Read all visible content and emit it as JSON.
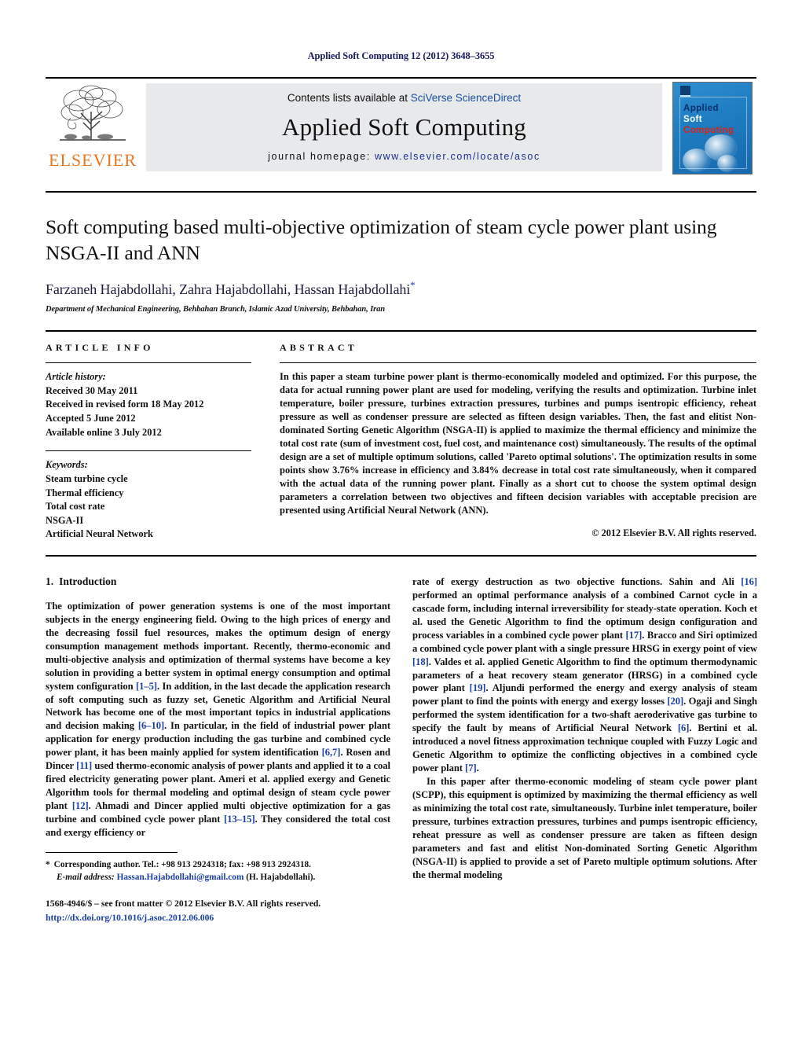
{
  "running_head": "Applied Soft Computing 12 (2012) 3648–3655",
  "banner": {
    "publisher_logo_text": "ELSEVIER",
    "contents_prefix": "Contents lists available at ",
    "contents_link": "SciVerse ScienceDirect",
    "journal_title": "Applied Soft Computing",
    "homepage_prefix": "journal homepage: ",
    "homepage_url": "www.elsevier.com/locate/asoc",
    "cover": {
      "line1": "Applied",
      "line2": "Soft",
      "line3": "Computing",
      "color_line1": "#0b2f6b",
      "color_line2": "#ffffff",
      "color_line3": "#e02213",
      "background_color": "#1f7ec2"
    }
  },
  "article": {
    "title": "Soft computing based multi-objective optimization of steam cycle power plant using NSGA-II and ANN",
    "authors": "Farzaneh Hajabdollahi, Zahra Hajabdollahi, Hassan Hajabdollahi",
    "corresponding_marker": "*",
    "affiliation": "Department of Mechanical Engineering, Behbahan Branch, Islamic Azad University, Behbahan, Iran"
  },
  "article_info": {
    "label": "ARTICLE INFO",
    "history_label": "Article history:",
    "history": [
      "Received 30 May 2011",
      "Received in revised form 18 May 2012",
      "Accepted 5 June 2012",
      "Available online 3 July 2012"
    ],
    "keywords_label": "Keywords:",
    "keywords": [
      "Steam turbine cycle",
      "Thermal efficiency",
      "Total cost rate",
      "NSGA-II",
      "Artificial Neural Network"
    ]
  },
  "abstract": {
    "label": "ABSTRACT",
    "text": "In this paper a steam turbine power plant is thermo-economically modeled and optimized. For this purpose, the data for actual running power plant are used for modeling, verifying the results and optimization. Turbine inlet temperature, boiler pressure, turbines extraction pressures, turbines and pumps isentropic efficiency, reheat pressure as well as condenser pressure are selected as fifteen design variables. Then, the fast and elitist Non-dominated Sorting Genetic Algorithm (NSGA-II) is applied to maximize the thermal efficiency and minimize the total cost rate (sum of investment cost, fuel cost, and maintenance cost) simultaneously. The results of the optimal design are a set of multiple optimum solutions, called 'Pareto optimal solutions'. The optimization results in some points show 3.76% increase in efficiency and 3.84% decrease in total cost rate simultaneously, when it compared with the actual data of the running power plant. Finally as a short cut to choose the system optimal design parameters a correlation between two objectives and fifteen decision variables with acceptable precision are presented using Artificial Neural Network (ANN).",
    "copyright": "© 2012 Elsevier B.V. All rights reserved."
  },
  "introduction": {
    "heading_number": "1.",
    "heading_text": "Introduction",
    "left_paragraph_1_a": "The optimization of power generation systems is one of the most important subjects in the energy engineering field. Owing to the high prices of energy and the decreasing fossil fuel resources, makes the optimum design of energy consumption management methods important. Recently, thermo-economic and multi-objective analysis and optimization of thermal systems have become a key solution in providing a better system in optimal energy consumption and optimal system configuration ",
    "cite_1_5": "[1–5]",
    "left_paragraph_1_b": ". In addition, in the last decade the application research of soft computing such as fuzzy set, Genetic Algorithm and Artificial Neural Network has become one of the most important topics in industrial applications and decision making ",
    "cite_6_10": "[6–10]",
    "left_paragraph_1_c": ". In particular, in the field of industrial power plant application for energy production including the gas turbine and combined cycle power plant, it has been mainly applied for system identification ",
    "cite_6_7": "[6,7]",
    "left_paragraph_1_d": ". Rosen and Dincer ",
    "cite_11": "[11]",
    "left_paragraph_1_e": " used thermo-economic analysis of power plants and applied it to a coal fired electricity generating power plant. Ameri et al. applied exergy and Genetic Algorithm tools for thermal modeling and optimal design of steam cycle power plant ",
    "cite_12": "[12]",
    "left_paragraph_1_f": ". Ahmadi and Dincer applied multi objective optimization for a gas turbine and combined cycle power plant ",
    "cite_13_15": "[13–15]",
    "left_paragraph_1_g": ". They considered the total cost and exergy efficiency or",
    "right_paragraph_1_a": "rate of exergy destruction as two objective functions. Sahin and Ali ",
    "cite_16": "[16]",
    "right_paragraph_1_b": " performed an optimal performance analysis of a combined Carnot cycle in a cascade form, including internal irreversibility for steady-state operation. Koch et al. used the Genetic Algorithm to find the optimum design configuration and process variables in a combined cycle power plant ",
    "cite_17": "[17]",
    "right_paragraph_1_c": ". Bracco and Siri optimized a combined cycle power plant with a single pressure HRSG in exergy point of view ",
    "cite_18": "[18]",
    "right_paragraph_1_d": ". Valdes et al. applied Genetic Algorithm to find the optimum thermodynamic parameters of a heat recovery steam generator (HRSG) in a combined cycle power plant ",
    "cite_19": "[19]",
    "right_paragraph_1_e": ". Aljundi performed the energy and exergy analysis of steam power plant to find the points with energy and exergy losses ",
    "cite_20": "[20]",
    "right_paragraph_1_f": ". Ogaji and Singh performed the system identification for a two-shaft aeroderivative gas turbine to specify the fault by means of Artificial Neural Network ",
    "cite_6": "[6]",
    "right_paragraph_1_g": ". Bertini et al. introduced a novel fitness approximation technique coupled with Fuzzy Logic and Genetic Algorithm to optimize the conflicting objectives in a combined cycle power plant ",
    "cite_7": "[7]",
    "right_paragraph_1_h": ".",
    "right_paragraph_2": "In this paper after thermo-economic modeling of steam cycle power plant (SCPP), this equipment is optimized by maximizing the thermal efficiency as well as minimizing the total cost rate, simultaneously. Turbine inlet temperature, boiler pressure, turbines extraction pressures, turbines and pumps isentropic efficiency, reheat pressure as well as condenser pressure are taken as fifteen design parameters and fast and elitist Non-dominated Sorting Genetic Algorithm (NSGA-II) is applied to provide a set of Pareto multiple optimum solutions. After the thermal modeling"
  },
  "footnotes": {
    "star": "*",
    "corresponding_text": "Corresponding author. Tel.: +98 913 2924318; fax: +98 913 2924318.",
    "email_label": "E-mail address:",
    "email": "Hassan.Hajabdollahi@gmail.com",
    "email_suffix": "(H. Hajabdollahi).",
    "issn_line": "1568-4946/$ – see front matter © 2012 Elsevier B.V. All rights reserved.",
    "doi": "http://dx.doi.org/10.1016/j.asoc.2012.06.006"
  }
}
